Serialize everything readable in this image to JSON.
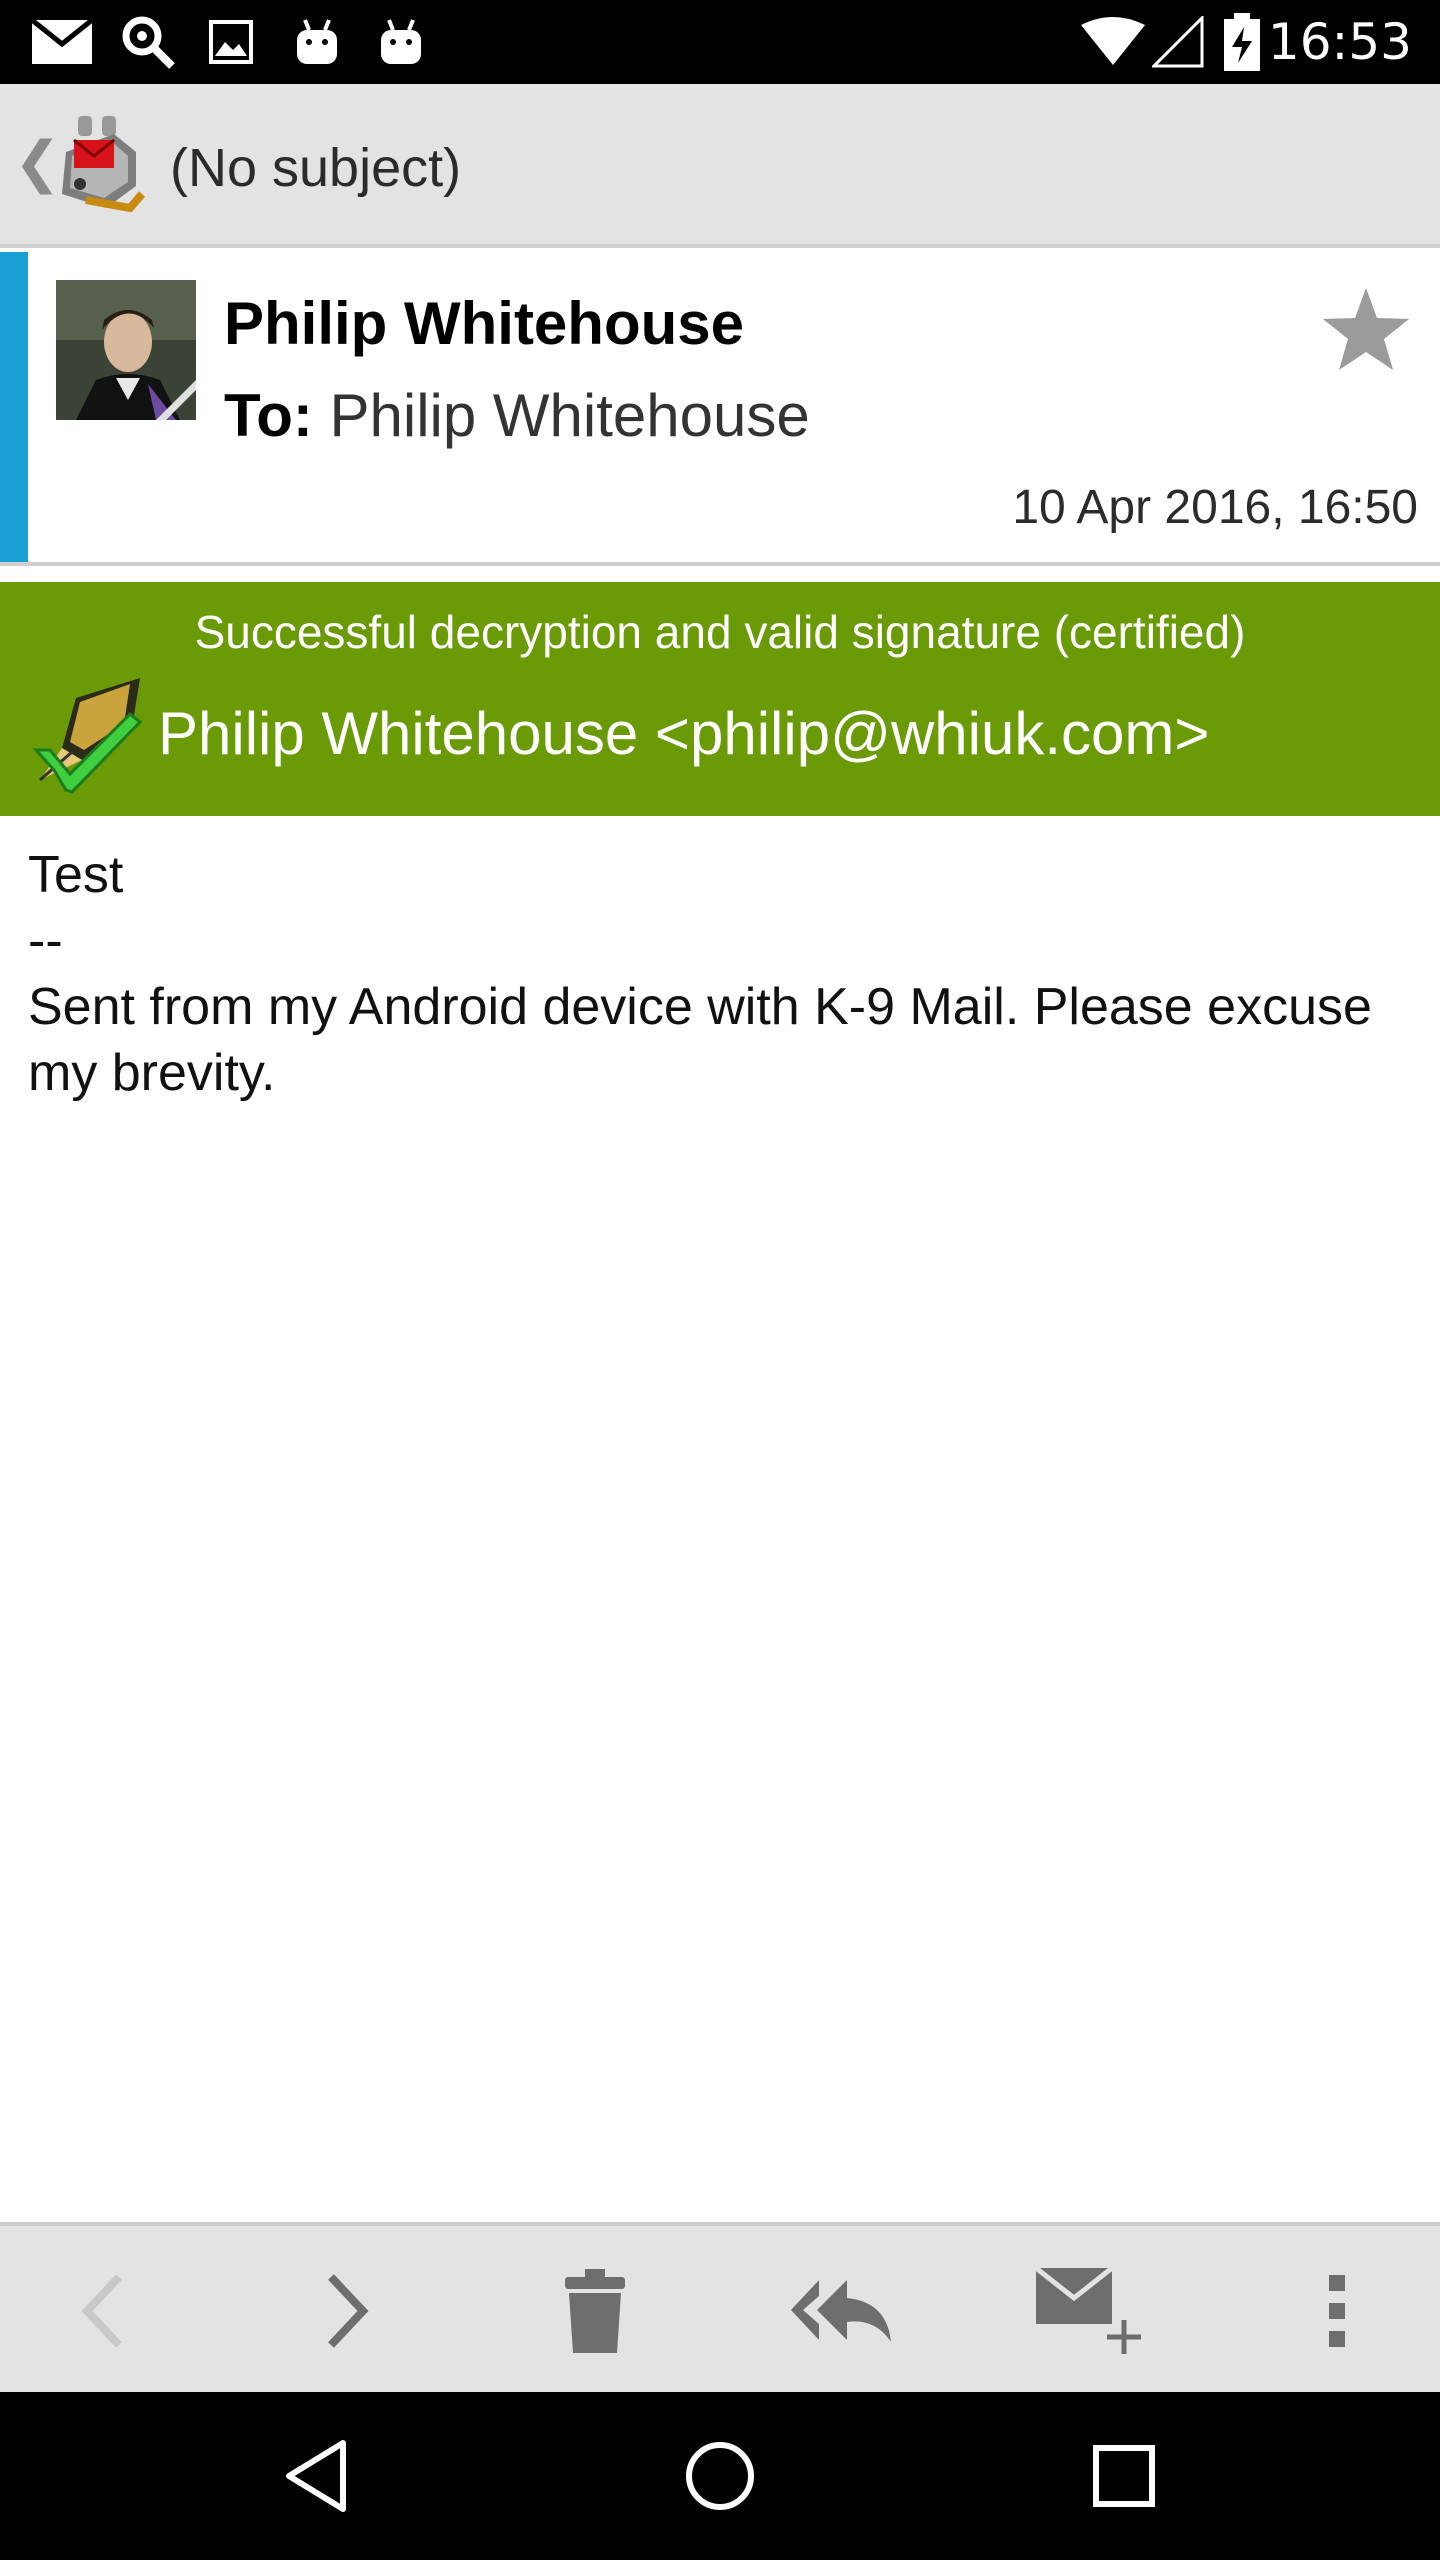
{
  "status_bar": {
    "time": "16:53",
    "notification_icons": [
      "mail-icon",
      "key-search-icon",
      "image-icon",
      "android-icon",
      "android-icon"
    ],
    "system_icons": [
      "wifi-icon",
      "signal-icon",
      "battery-charging-icon"
    ]
  },
  "action_bar": {
    "title": "(No subject)",
    "app_icon": "k9-mail-logo"
  },
  "header": {
    "sender": "Philip Whitehouse",
    "to_label": "To:",
    "to_value": "Philip Whitehouse",
    "date": "10 Apr 2016, 16:50",
    "accent_color": "#1a9fd4"
  },
  "crypto": {
    "status": "Successful decryption and valid signature (certified)",
    "user": "Philip Whitehouse <philip@whiuk.com>",
    "color": "#6a9a06"
  },
  "message": {
    "lines": [
      "Test",
      "--",
      "Sent from my Android device with K-9 Mail. Please excuse my brevity."
    ]
  },
  "toolbar": {
    "items": [
      "previous-icon",
      "next-icon",
      "delete-icon",
      "reply-all-icon",
      "compose-icon",
      "overflow-menu-icon"
    ]
  },
  "nav_bar": {
    "items": [
      "back-icon",
      "home-icon",
      "recents-icon"
    ]
  }
}
